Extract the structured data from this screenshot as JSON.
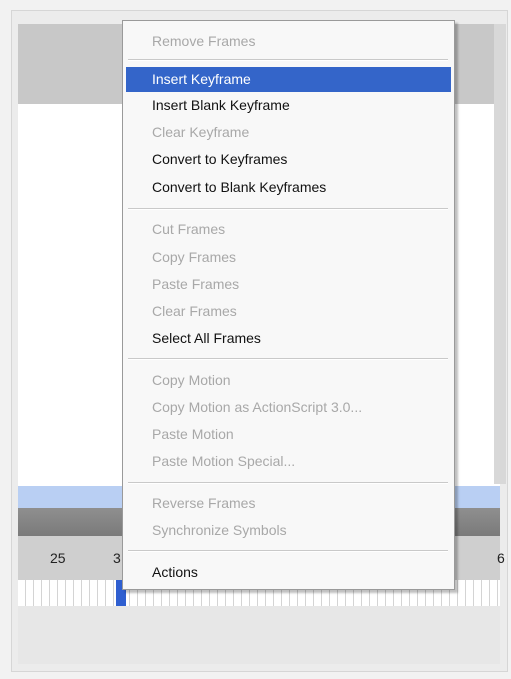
{
  "timeline": {
    "ruler_labels": [
      "25",
      "3",
      "6"
    ]
  },
  "context_menu": {
    "items": [
      {
        "label": "Remove Frames",
        "enabled": false
      },
      {
        "label": "Insert Keyframe",
        "enabled": true,
        "selected": true
      },
      {
        "label": "Insert Blank Keyframe",
        "enabled": true
      },
      {
        "label": "Clear Keyframe",
        "enabled": false
      },
      {
        "label": "Convert to Keyframes",
        "enabled": true
      },
      {
        "label": "Convert to Blank Keyframes",
        "enabled": true
      },
      {
        "label": "Cut Frames",
        "enabled": false
      },
      {
        "label": "Copy Frames",
        "enabled": false
      },
      {
        "label": "Paste Frames",
        "enabled": false
      },
      {
        "label": "Clear Frames",
        "enabled": false
      },
      {
        "label": "Select All Frames",
        "enabled": true
      },
      {
        "label": "Copy Motion",
        "enabled": false
      },
      {
        "label": "Copy Motion as ActionScript 3.0...",
        "enabled": false
      },
      {
        "label": "Paste Motion",
        "enabled": false
      },
      {
        "label": "Paste Motion Special...",
        "enabled": false
      },
      {
        "label": "Reverse Frames",
        "enabled": false
      },
      {
        "label": "Synchronize Symbols",
        "enabled": false
      },
      {
        "label": "Actions",
        "enabled": true
      }
    ]
  },
  "colors": {
    "highlight": "#3465c9",
    "disabled_text": "#a8a8a8",
    "selection_band": "#b9cff3"
  }
}
